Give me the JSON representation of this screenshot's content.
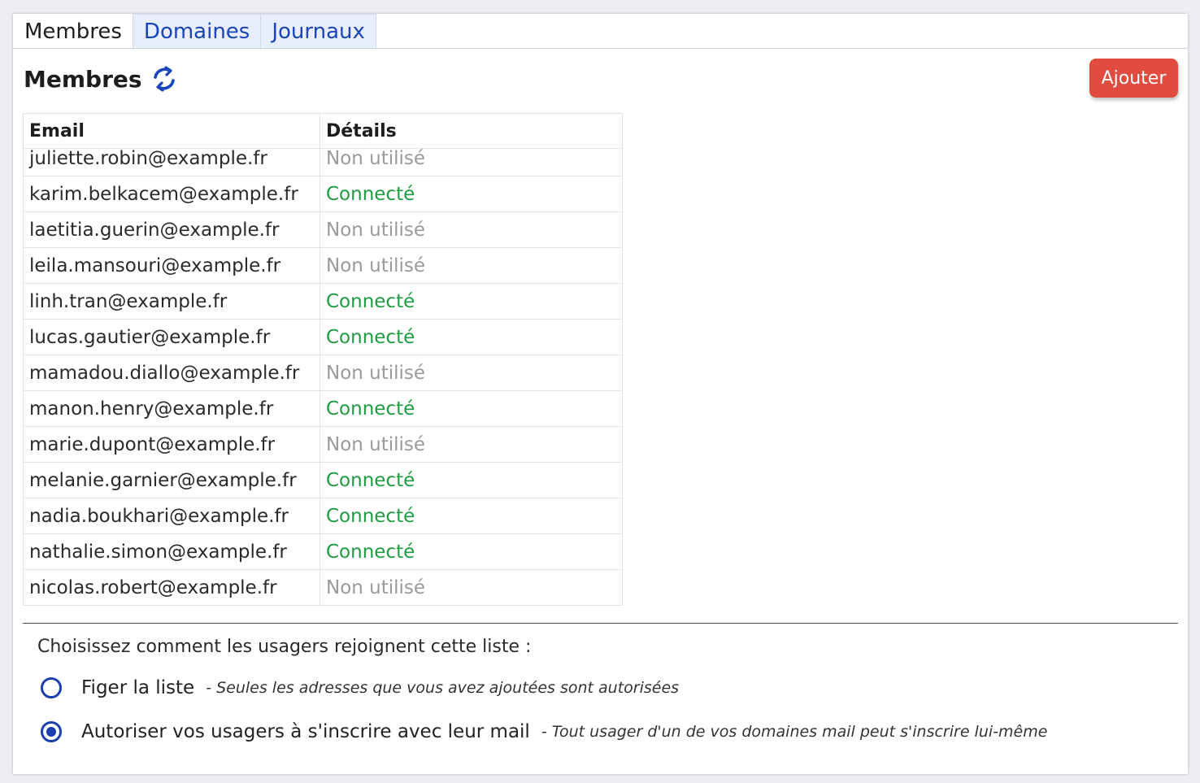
{
  "tabs": [
    {
      "label": "Membres",
      "active": true
    },
    {
      "label": "Domaines",
      "active": false
    },
    {
      "label": "Journaux",
      "active": false
    }
  ],
  "header": {
    "title": "Membres",
    "refresh_icon": "refresh-icon",
    "add_label": "Ajouter"
  },
  "table": {
    "columns": [
      "Email",
      "Détails"
    ],
    "rows": [
      {
        "email": "juliette.robin@example.fr",
        "status": "Non utilisé",
        "connected": false
      },
      {
        "email": "karim.belkacem@example.fr",
        "status": "Connecté",
        "connected": true
      },
      {
        "email": "laetitia.guerin@example.fr",
        "status": "Non utilisé",
        "connected": false
      },
      {
        "email": "leila.mansouri@example.fr",
        "status": "Non utilisé",
        "connected": false
      },
      {
        "email": "linh.tran@example.fr",
        "status": "Connecté",
        "connected": true
      },
      {
        "email": "lucas.gautier@example.fr",
        "status": "Connecté",
        "connected": true
      },
      {
        "email": "mamadou.diallo@example.fr",
        "status": "Non utilisé",
        "connected": false
      },
      {
        "email": "manon.henry@example.fr",
        "status": "Connecté",
        "connected": true
      },
      {
        "email": "marie.dupont@example.fr",
        "status": "Non utilisé",
        "connected": false
      },
      {
        "email": "melanie.garnier@example.fr",
        "status": "Connecté",
        "connected": true
      },
      {
        "email": "nadia.boukhari@example.fr",
        "status": "Connecté",
        "connected": true
      },
      {
        "email": "nathalie.simon@example.fr",
        "status": "Connecté",
        "connected": true
      },
      {
        "email": "nicolas.robert@example.fr",
        "status": "Non utilisé",
        "connected": false
      }
    ]
  },
  "join_options": {
    "question": "Choisissez comment les usagers rejoignent cette liste :",
    "options": [
      {
        "label": "Figer la liste",
        "description": "- Seules les adresses que vous avez ajoutées sont autorisées",
        "selected": false
      },
      {
        "label": "Autoriser vos usagers à s'inscrire avec leur mail",
        "description": "- Tout usager d'un de vos domaines mail peut s'inscrire lui-même",
        "selected": true
      }
    ]
  },
  "colors": {
    "accent": "#1a45b8",
    "add_button": "#e24c3f",
    "connected": "#1e9c43",
    "unused": "#9a9a9a"
  }
}
